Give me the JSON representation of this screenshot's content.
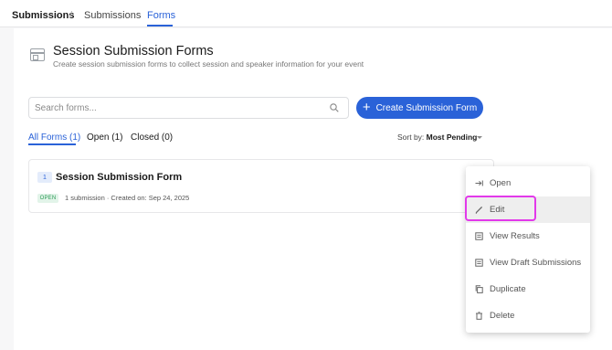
{
  "nav": {
    "root": "Submissions",
    "separator": "/",
    "tabs": [
      {
        "label": "Submissions"
      },
      {
        "label": "Forms"
      }
    ]
  },
  "header": {
    "title": "Session Submission Forms",
    "subtitle": "Create session submission forms to collect session and speaker information for your event",
    "icon": "form-icon"
  },
  "search": {
    "placeholder": "Search forms..."
  },
  "create_button": {
    "label": "Create Submission Form"
  },
  "filter_tabs": [
    {
      "label": "All Forms (1)"
    },
    {
      "label": "Open (1)"
    },
    {
      "label": "Closed (0)"
    }
  ],
  "sort": {
    "prefix": "Sort by: ",
    "value": "Most Pending"
  },
  "form": {
    "number": "1",
    "title": "Session Submission Form",
    "status": "OPEN",
    "meta": "1 submission · Created on: Sep 24, 2025"
  },
  "menu": {
    "items": [
      {
        "label": "Open",
        "icon": "open-arrow-icon"
      },
      {
        "label": "Edit",
        "icon": "pencil-icon"
      },
      {
        "label": "View Results",
        "icon": "results-icon"
      },
      {
        "label": "View Draft Submissions",
        "icon": "drafts-icon"
      },
      {
        "label": "Duplicate",
        "icon": "copy-icon"
      },
      {
        "label": "Delete",
        "icon": "trash-icon"
      }
    ]
  },
  "colors": {
    "accent": "#2a62d8",
    "highlight_ring": "#e239ea",
    "status_open": "#2b9a55"
  }
}
